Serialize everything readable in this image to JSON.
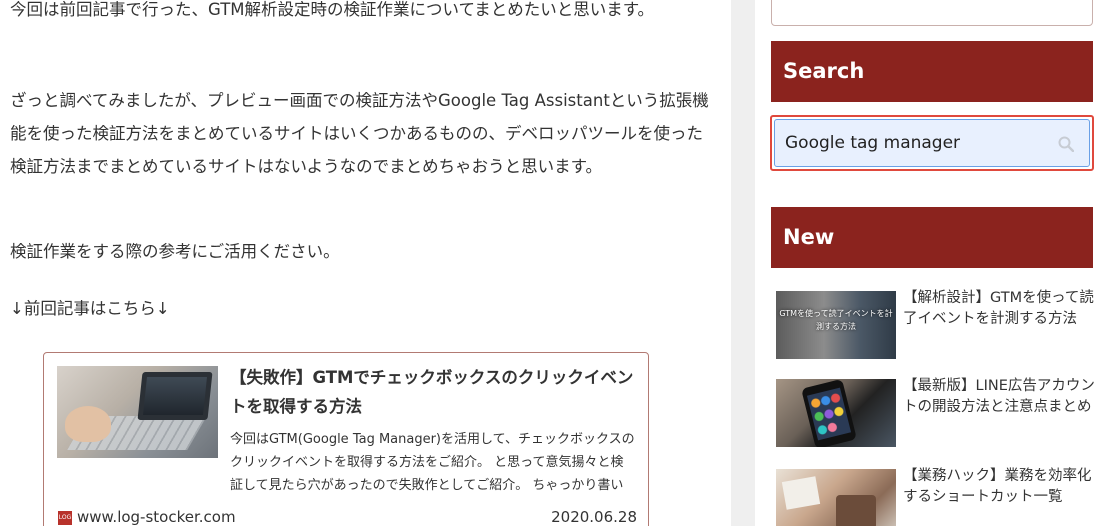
{
  "article": {
    "paragraph1": "今回は前回記事で行った、GTM解析設定時の検証作業についてまとめたいと思います。",
    "paragraph2": "ざっと調べてみましたが、プレビュー画面での検証方法やGoogle Tag Assistantという拡張機能を使った検証方法をまとめているサイトはいくつかあるものの、デベロッパツールを使った検証方法までまとめているサイトはないようなのでまとめちゃおうと思います。",
    "paragraph3": "検証作業をする際の参考にご活用ください。",
    "paragraph4": "↓前回記事はこちら↓",
    "card": {
      "title": "【失敗作】GTMでチェックボックスのクリックイベントを取得する方法",
      "description": "今回はGTM(Google Tag Manager)を活用して、チェックボックスのクリックイベントを取得する方法をご紹介。 と思って意気揚々と検証して見たら穴があったので失敗作としてご紹介。 ちゃっかり書いた最後の最後に現環境では計",
      "site": "www.log-stocker.com",
      "date": "2020.06.28"
    }
  },
  "sidebar": {
    "search_heading": "Search",
    "search_value": "Google tag manager",
    "new_heading": "New",
    "posts": [
      {
        "title": "【解析設計】GTMを使って読了イベントを計測する方法",
        "thumb_text": "GTMを使って読了イベントを計測する方法"
      },
      {
        "title": "【最新版】LINE広告アカウントの開設方法と注意点まとめ"
      },
      {
        "title": "【業務ハック】業務を効率化するショートカット一覧"
      }
    ]
  },
  "colors": {
    "heading_bg": "#8b231e",
    "search_highlight": "#e0493d",
    "input_bg": "#e8f0fe"
  }
}
